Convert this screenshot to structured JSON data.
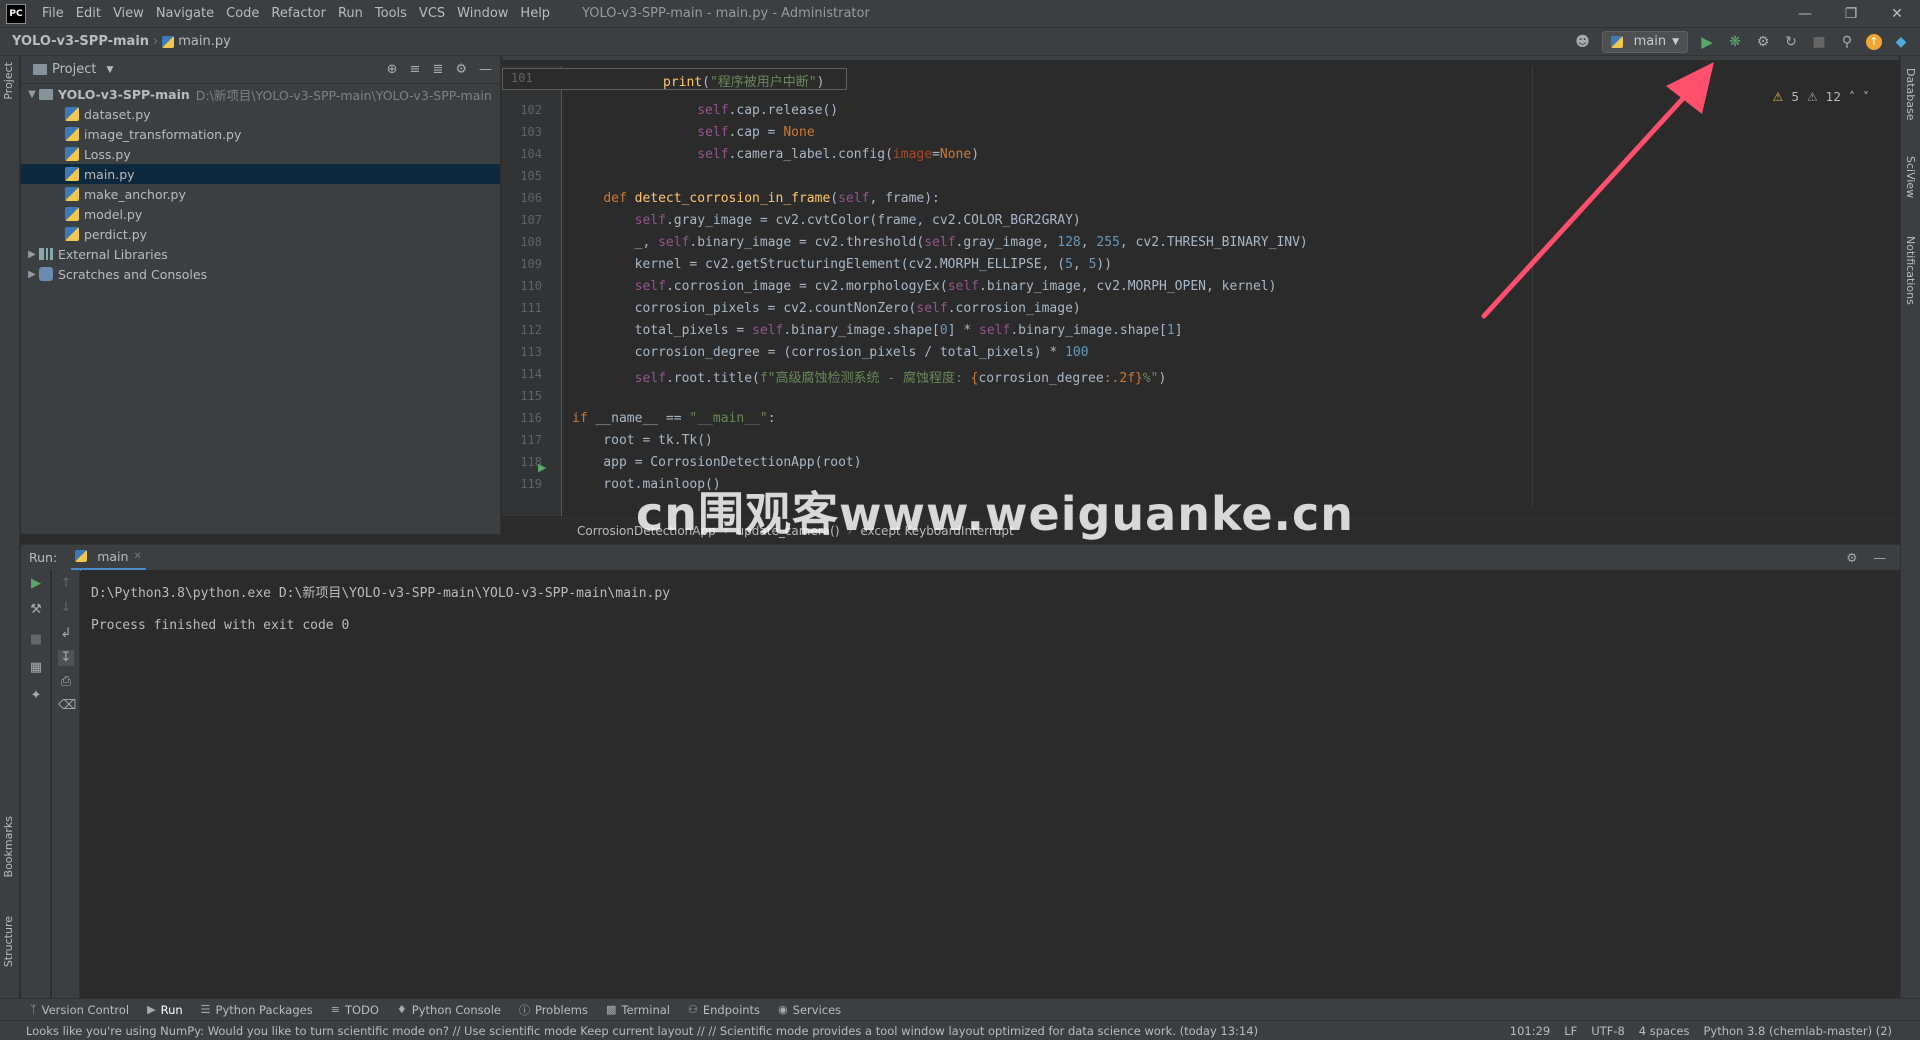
{
  "titlebar": {
    "logo": "PC",
    "menus": [
      "File",
      "Edit",
      "View",
      "Navigate",
      "Code",
      "Refactor",
      "Run",
      "Tools",
      "VCS",
      "Window",
      "Help"
    ],
    "title": "YOLO-v3-SPP-main - main.py - Administrator"
  },
  "navbar": {
    "project": "YOLO-v3-SPP-main",
    "file": "main.py",
    "run_config": "main"
  },
  "project_panel": {
    "header": "Project",
    "root": {
      "name": "YOLO-v3-SPP-main",
      "path": "D:\\新项目\\YOLO-v3-SPP-main\\YOLO-v3-SPP-main"
    },
    "files": [
      "dataset.py",
      "image_transformation.py",
      "Loss.py",
      "main.py",
      "make_anchor.py",
      "model.py",
      "perdict.py"
    ],
    "selected": "main.py",
    "external": "External Libraries",
    "scratches": "Scratches and Consoles"
  },
  "editor": {
    "inspections": {
      "warnings": "5",
      "weak_warnings": "12"
    },
    "sticky_line_no": "101",
    "line_numbers": [
      "102",
      "103",
      "104",
      "105",
      "106",
      "107",
      "108",
      "109",
      "110",
      "111",
      "112",
      "113",
      "114",
      "115",
      "116",
      "117",
      "118",
      "119"
    ],
    "breadcrumb": [
      "CorrosionDetectionApp",
      "update_camera()",
      "except KeyboardInterrupt"
    ]
  },
  "run_panel": {
    "label": "Run:",
    "tab": "main",
    "console": [
      "D:\\Python3.8\\python.exe D:\\新项目\\YOLO-v3-SPP-main\\YOLO-v3-SPP-main\\main.py",
      "",
      "Process finished with exit code 0"
    ]
  },
  "left_strip": {
    "project": "Project",
    "bookmarks": "Bookmarks",
    "structure": "Structure"
  },
  "right_strip": {
    "database": "Database",
    "sciview": "SciView",
    "notifications": "Notifications"
  },
  "toolwindows": [
    "Version Control",
    "Run",
    "Python Packages",
    "TODO",
    "Python Console",
    "Problems",
    "Terminal",
    "Endpoints",
    "Services"
  ],
  "statusbar": {
    "message": "Looks like you're using NumPy: Would you like to turn scientific mode on? // Use scientific mode   Keep current layout // // Scientific mode provides a tool window layout optimized for data science work. (today 13:14)",
    "position": "101:29",
    "line_sep": "LF",
    "encoding": "UTF-8",
    "indent": "4 spaces",
    "interpreter": "Python 3.8 (chemlab-master) (2)"
  },
  "watermark": "cn围观客www.weiguanke.cn",
  "colors": {
    "accent": "#4a88c7",
    "run_green": "#59a869",
    "arrow_red": "#ff4f6d"
  }
}
